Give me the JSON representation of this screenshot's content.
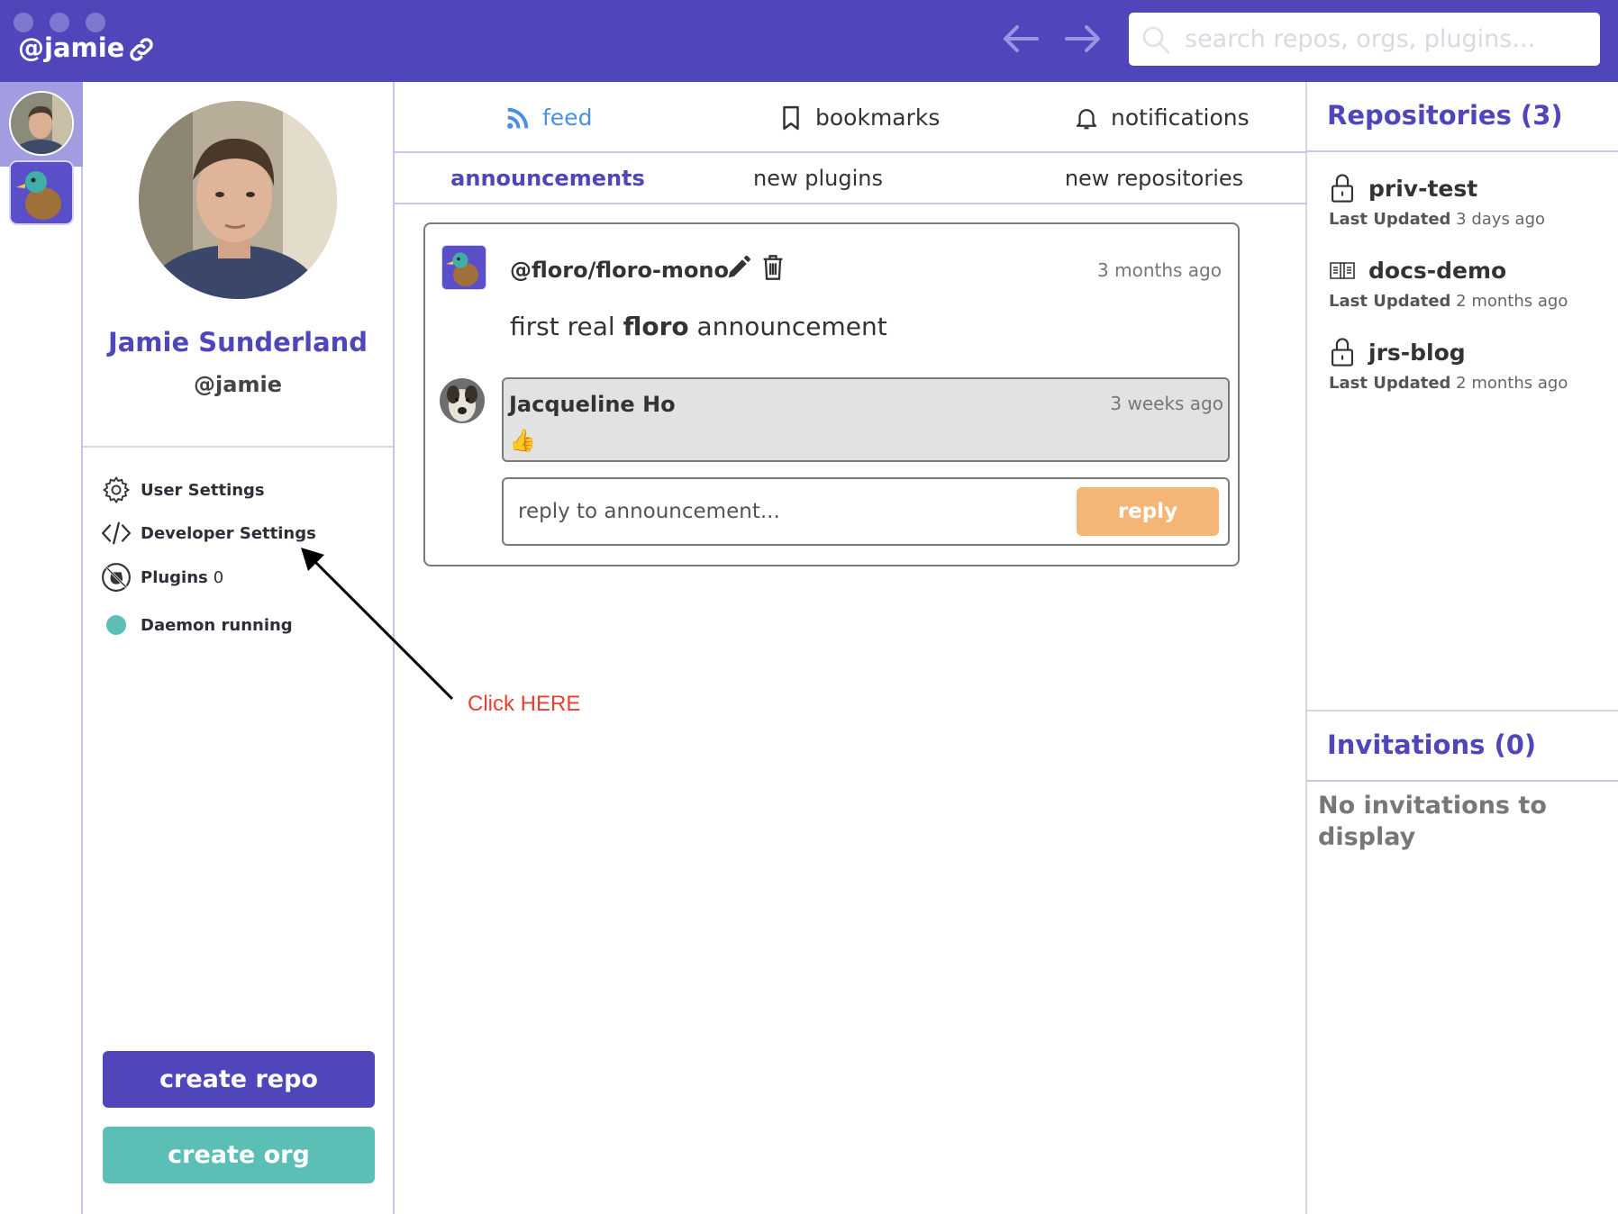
{
  "titlebar": {
    "handle": "@jamie",
    "search_placeholder": "search repos, orgs, plugins..."
  },
  "profile": {
    "full_name": "Jamie Sunderland",
    "handle": "@jamie"
  },
  "menu": {
    "user_settings": "User Settings",
    "developer_settings": "Developer Settings",
    "plugins_label": "Plugins",
    "plugins_count": "0",
    "daemon": "Daemon running"
  },
  "buttons": {
    "create_repo": "create repo",
    "create_org": "create org"
  },
  "tabs": {
    "feed": "feed",
    "bookmarks": "bookmarks",
    "notifications": "notifications"
  },
  "subtabs": {
    "announcements": "announcements",
    "new_plugins": "new plugins",
    "new_repositories": "new repositories"
  },
  "announcement": {
    "repo": "@floro/floro-mono",
    "time": "3 months ago",
    "text_prefix": "first real",
    "text_bold": "floro",
    "text_suffix": "announcement",
    "reply": {
      "author": "Jacqueline Ho",
      "time": "3 weeks ago",
      "emoji": "👍"
    },
    "reply_placeholder": "reply to announcement...",
    "reply_button": "reply"
  },
  "annotation": {
    "text": "Click HERE"
  },
  "repositories": {
    "title": "Repositories (3)",
    "updated_label": "Last Updated",
    "items": [
      {
        "name": "priv-test",
        "updated": "3 days ago",
        "icon": "lock-icon"
      },
      {
        "name": "docs-demo",
        "updated": "2 months ago",
        "icon": "book-icon"
      },
      {
        "name": "jrs-blog",
        "updated": "2 months ago",
        "icon": "lock-icon"
      }
    ]
  },
  "invitations": {
    "title": "Invitations (0)",
    "empty": "No invitations to display"
  },
  "colors": {
    "brand": "#4f46bb",
    "teal": "#5cbfb5",
    "reply_button": "#f4b575",
    "feed_active": "#4a90e2",
    "annotation": "#e8402f"
  }
}
